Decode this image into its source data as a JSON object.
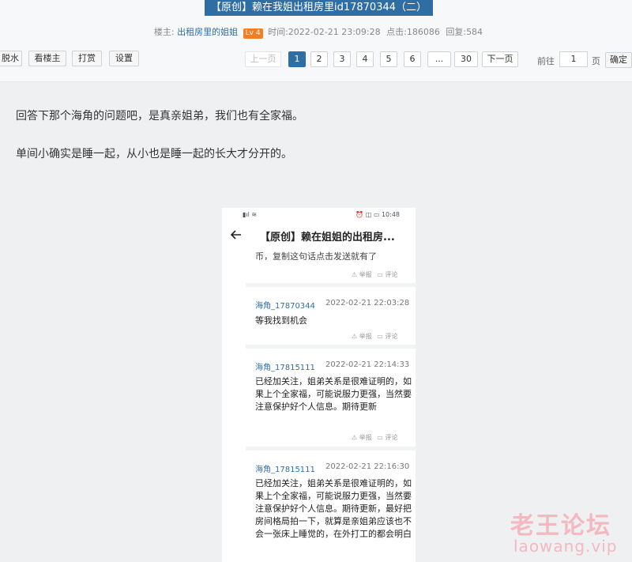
{
  "thread": {
    "title": "【原创】赖在我姐出租房里id17870344（二）",
    "meta": {
      "author_label": "楼主:",
      "author": "出租房里的姐姐",
      "level": "Lv 4",
      "time_label": "时间:",
      "time": "2022-02-21 23:09:28",
      "clicks_label": "点击:",
      "clicks": "186086",
      "replies_label": "回复:",
      "replies": "584"
    }
  },
  "toolbar": {
    "water": "脱水",
    "view_op": "看楼主",
    "tip": "打赏",
    "settings": "设置"
  },
  "pagination": {
    "prev": "上一页",
    "pages": [
      "1",
      "2",
      "3",
      "4",
      "5",
      "6"
    ],
    "ellipsis": "...",
    "last": "30",
    "next": "下一页",
    "goto_label": "前往",
    "goto_value": "1",
    "page_unit": "页",
    "confirm": "确定"
  },
  "content": {
    "para1": "回答下那个海角的问题吧，是真亲姐弟，我们也有全家福。",
    "para2": "单间小确实是睡一起，从小也是睡一起的长大才分开的。"
  },
  "phone": {
    "status_left": "▮ıl ≋",
    "status_right": "⏰ ◫ ▭ 10:48",
    "app_title": "【原创】赖在姐姐的出租房...",
    "cut_text": "币，复制这句话点击发送就有了",
    "report": "⚠ 举报",
    "comment_action": "▭ 评论",
    "comments": [
      {
        "user": "海角_17870344",
        "time": "2022-02-21 22:03:28",
        "text": "等我找到机会"
      },
      {
        "user": "海角_17815111",
        "time": "2022-02-21 22:14:33",
        "text": "已经加关注，姐弟关系是很难证明的，如果上个全家福，可能说服力更强，当然要注意保护好个人信息。期待更新"
      },
      {
        "user": "海角_17815111",
        "time": "2022-02-21 22:16:30",
        "text": "已经加关注，姐弟关系是很难证明的，如果上个全家福，可能说服力更强，当然要注意保护好个人信息。期待更新，最好把房间格局拍一下，就算是亲姐弟应该也不会一张床上睡觉的，在外打工的都会明白"
      }
    ]
  },
  "watermark": {
    "cn": "老王论坛",
    "en": "laowang.vip"
  },
  "colors": {
    "accent": "#2f6ea5",
    "level_badge": "#f07f26",
    "watermark": "#f4b8bf"
  }
}
